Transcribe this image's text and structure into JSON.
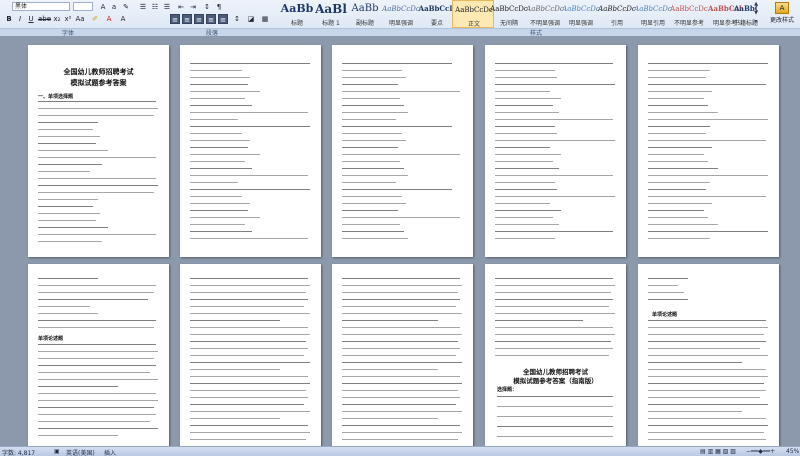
{
  "toolbar": {
    "font_name": "黑体",
    "font_size": "",
    "group_font": "字体",
    "group_paragraph": "段落",
    "group_styles": "样式",
    "change_styles": "更改样式"
  },
  "styles": [
    {
      "sample": "AaBb",
      "name": "标题"
    },
    {
      "sample": "AaBl",
      "name": "标题 1"
    },
    {
      "sample": "AaBb",
      "name": "副标题"
    },
    {
      "sample": "AaBbCcDc",
      "name": "明显强调"
    },
    {
      "sample": "AaBbCcD",
      "name": "要点"
    },
    {
      "sample": "AaBbCcDc",
      "name": "正文",
      "selected": true
    },
    {
      "sample": "AaBbCcDc",
      "name": "无间隔"
    },
    {
      "sample": "AaBbCcDc",
      "name": "不明显强调"
    },
    {
      "sample": "AaBbCcDc",
      "name": "明显强调"
    },
    {
      "sample": "AaBbCcDc",
      "name": "引用"
    },
    {
      "sample": "AaBbCcDc",
      "name": "明显引用"
    },
    {
      "sample": "AaBbCcDc",
      "name": "不明显参考"
    },
    {
      "sample": "AaBbCcI",
      "name": "明显参考"
    },
    {
      "sample": "AaBbCcI",
      "name": "书籍标题"
    }
  ],
  "pages": {
    "p1_title_line1": "全国幼儿教师招聘考试",
    "p1_title_line2": "模拟试题参考答案",
    "p1_section": "一、单项选择题",
    "p7_section": "单项论述题",
    "p9_title_line1": "全国幼儿教师招聘考试",
    "p9_title_line2": "模拟试题参考答案（指南版）",
    "p9_section": "选择题：",
    "p10_section": "单项论述题"
  },
  "status": {
    "words": "字数: 4,817",
    "language": "英语(美国)",
    "mode": "插入",
    "zoom": "45%"
  }
}
